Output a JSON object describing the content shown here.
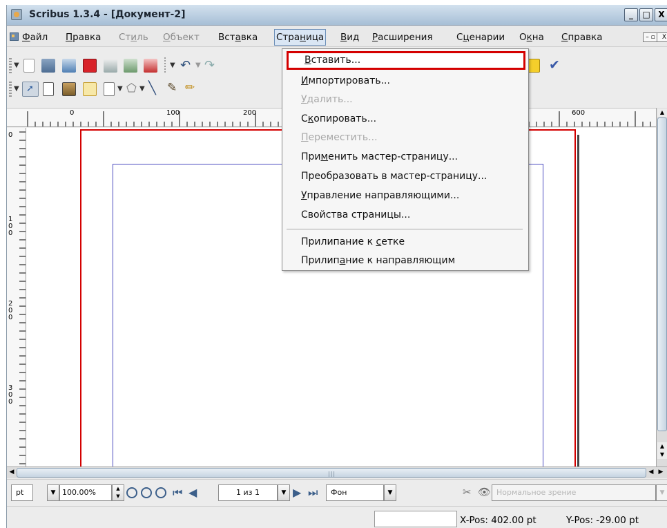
{
  "window": {
    "title": "Scribus 1.3.4 - [Документ-2]",
    "minimize": "_",
    "maximize": "□",
    "close": "X"
  },
  "menubar": {
    "items": [
      {
        "label": "Файл",
        "u": "Ф",
        "dim": false
      },
      {
        "label": "Правка",
        "u": "П",
        "dim": false
      },
      {
        "label": "Стиль",
        "u": "и",
        "dim": true
      },
      {
        "label": "Объект",
        "u": "О",
        "dim": true
      },
      {
        "label": "Вставка",
        "u": "а",
        "dim": false
      },
      {
        "label": "Страница",
        "u": "н",
        "dim": false,
        "active": true
      },
      {
        "label": "Вид",
        "u": "В",
        "dim": false
      },
      {
        "label": "Расширения",
        "u": "Р",
        "dim": false
      },
      {
        "label": "Сценарии",
        "u": "ц",
        "dim": false
      },
      {
        "label": "Окна",
        "u": "к",
        "dim": false
      },
      {
        "label": "Справка",
        "u": "С",
        "dim": false
      }
    ]
  },
  "page_menu": {
    "items": [
      {
        "label": "Вставить...",
        "u": "В",
        "disabled": false,
        "highlighted": true
      },
      {
        "label": "Импортировать...",
        "u": "И",
        "disabled": false
      },
      {
        "label": "Удалить...",
        "u": "У",
        "disabled": true
      },
      {
        "label": "Скопировать...",
        "u": "к",
        "disabled": false
      },
      {
        "label": "Переместить...",
        "u": "П",
        "disabled": true
      },
      {
        "label": "Применить мастер-страницу...",
        "u": "м",
        "disabled": false
      },
      {
        "label": "Преобразовать в мастер-страницу...",
        "u": "",
        "disabled": false
      },
      {
        "label": "Управление направляющими...",
        "u": "У",
        "disabled": false
      },
      {
        "label": "Свойства страницы...",
        "u": "",
        "disabled": false
      },
      {
        "separator": true
      },
      {
        "label": "Прилипание к сетке",
        "u": "с",
        "disabled": false
      },
      {
        "label": "Прилипание к направляющим",
        "u": "а",
        "disabled": false
      }
    ]
  },
  "rulers": {
    "h_labels": [
      "0",
      "100",
      "200",
      "600"
    ],
    "v_labels": [
      "0",
      "1\n0\n0",
      "2\n0\n0",
      "3\n0\n0"
    ]
  },
  "bottombar": {
    "unit": "pt",
    "zoom": "100.00%",
    "page": "1 из 1",
    "layer": "Фон",
    "view_mode": "Нормальное зрение"
  },
  "statusbar": {
    "xpos": "X-Pos: 402.00 pt",
    "ypos": "Y-Pos: -29.00 pt"
  },
  "colors": {
    "highlight_border": "#d40000",
    "page_border": "#d30000",
    "margin_guide": "#4a4abf"
  }
}
